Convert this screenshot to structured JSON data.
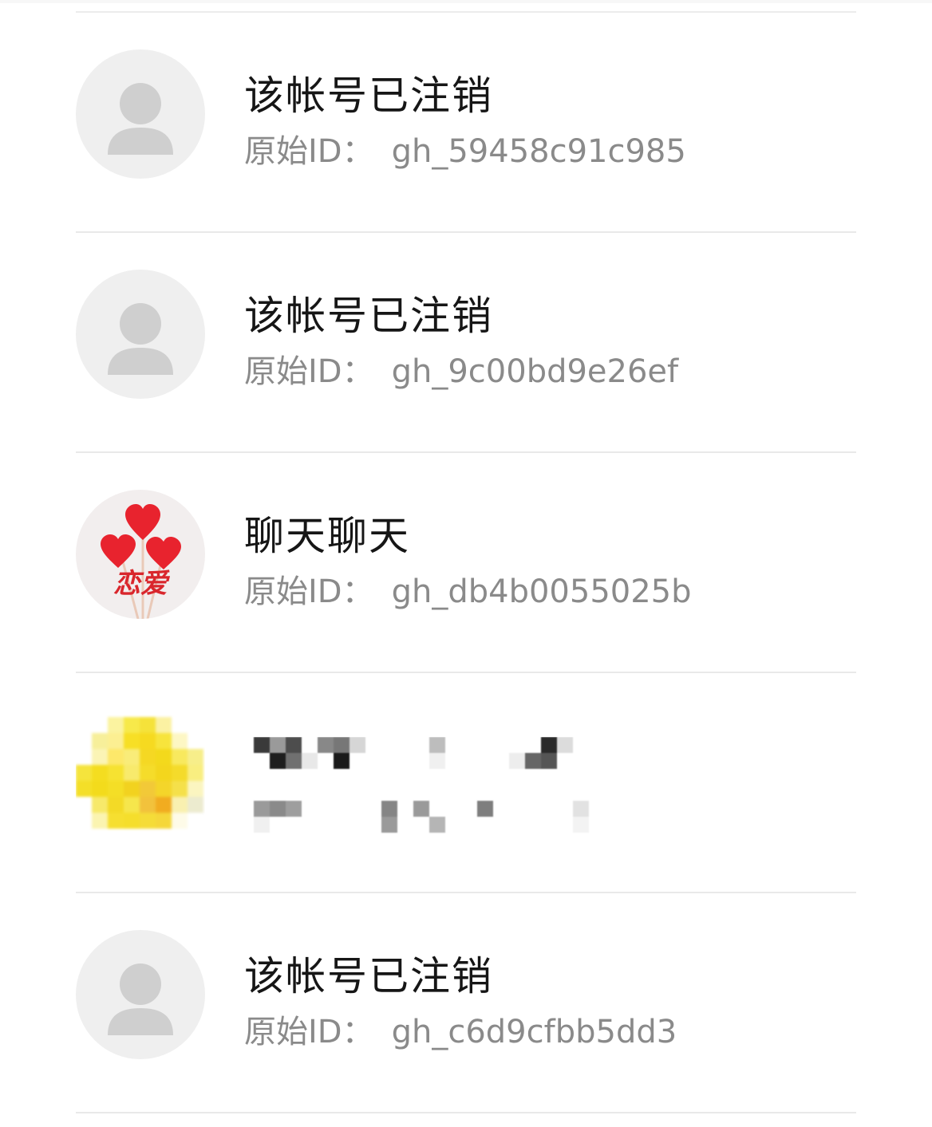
{
  "accounts": [
    {
      "name": "该帐号已注销",
      "id_label": "原始ID：",
      "id_value": "gh_59458c91c985",
      "avatar": "default-person-icon"
    },
    {
      "name": "该帐号已注销",
      "id_label": "原始ID：",
      "id_value": "gh_9c00bd9e26ef",
      "avatar": "default-person-icon"
    },
    {
      "name": "聊天聊天",
      "id_label": "原始ID：",
      "id_value": "gh_db4b0055025b",
      "avatar": "hearts-avatar",
      "avatar_text": "恋爱"
    },
    {
      "name": "",
      "id_label": "",
      "id_value": "",
      "avatar": "pixelated-yellow-avatar",
      "redacted": true
    },
    {
      "name": "该帐号已注销",
      "id_label": "原始ID：",
      "id_value": "gh_c6d9cfbb5dd3",
      "avatar": "default-person-icon"
    }
  ],
  "colors": {
    "title": "#161616",
    "subtitle": "#8a8a8a",
    "avatar_bg": "#efefef",
    "avatar_figure": "#cfcfcf",
    "divider": "#e9e9e9",
    "heart": "#e8232e",
    "avatar_text": "#d9262c"
  }
}
